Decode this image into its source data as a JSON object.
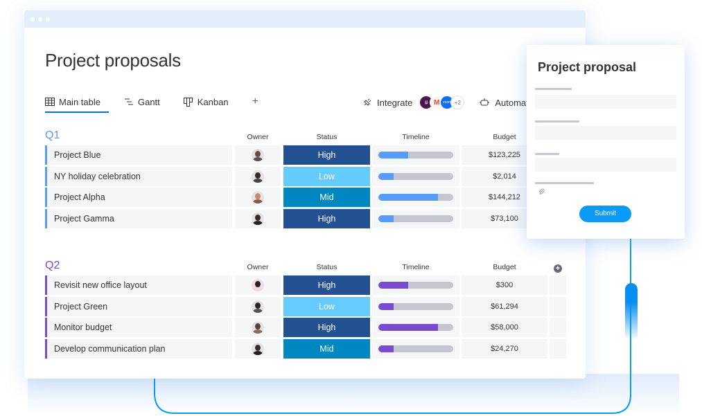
{
  "window": {
    "title": "Project proposals",
    "tabs": [
      {
        "label": "Main table",
        "icon": "table-icon",
        "active": true
      },
      {
        "label": "Gantt",
        "icon": "gantt-icon",
        "active": false
      },
      {
        "label": "Kanban",
        "icon": "kanban-icon",
        "active": false
      }
    ],
    "add_view_label": "+",
    "integrate_label": "Integrate",
    "integrations": [
      "slack-icon",
      "gmail-icon",
      "zoom-icon"
    ],
    "integrations_more": "+2",
    "automate_label": "Automate"
  },
  "columns": {
    "owner": "Owner",
    "status": "Status",
    "timeline": "Timeline",
    "budget": "Budget"
  },
  "status_colors": {
    "High": "#225091",
    "Low": "#66ccff",
    "Mid": "#0086c0"
  },
  "groups": [
    {
      "title": "Q1",
      "color": "#579bfc",
      "rows": [
        {
          "name": "Project Blue",
          "status": "High",
          "timeline": 0.4,
          "budget": "$123,225"
        },
        {
          "name": "NY holiday celebration",
          "status": "Low",
          "timeline": 0.2,
          "budget": "$2,014"
        },
        {
          "name": "Project Alpha",
          "status": "Mid",
          "timeline": 0.8,
          "budget": "$144,212"
        },
        {
          "name": "Project Gamma",
          "status": "High",
          "timeline": 0.2,
          "budget": "$73,100"
        }
      ]
    },
    {
      "title": "Q2",
      "color": "#784bd1",
      "rows": [
        {
          "name": "Revisit new office layout",
          "status": "High",
          "timeline": 0.4,
          "budget": "$300"
        },
        {
          "name": "Project Green",
          "status": "Low",
          "timeline": 0.2,
          "budget": "$61,294"
        },
        {
          "name": "Monitor budget",
          "status": "High",
          "timeline": 0.8,
          "budget": "$58,000"
        },
        {
          "name": "Develop communication plan",
          "status": "Mid",
          "timeline": 0.2,
          "budget": "$24,270"
        }
      ]
    }
  ],
  "form": {
    "title": "Project proposal",
    "submit_label": "Submit",
    "attach_icon": "paperclip-icon"
  }
}
